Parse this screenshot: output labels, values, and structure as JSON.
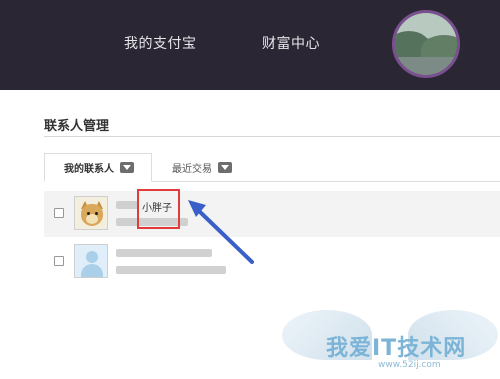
{
  "header": {
    "nav": [
      {
        "label": "我的支付宝"
      },
      {
        "label": "财富中心"
      }
    ]
  },
  "page": {
    "title": "联系人管理"
  },
  "tabs": [
    {
      "label": "我的联系人",
      "active": true
    },
    {
      "label": "最近交易",
      "active": false
    }
  ],
  "contacts": [
    {
      "nickname": "小胖子",
      "avatar": "doge-avatar",
      "checked": false
    },
    {
      "nickname": "",
      "avatar": "default-avatar",
      "checked": false
    }
  ],
  "annotation": {
    "box_color": "#e23b3b",
    "arrow_color": "#3a5fc8"
  },
  "watermark": {
    "text": "我爱IT技术网",
    "url": "www.52ij.com"
  }
}
